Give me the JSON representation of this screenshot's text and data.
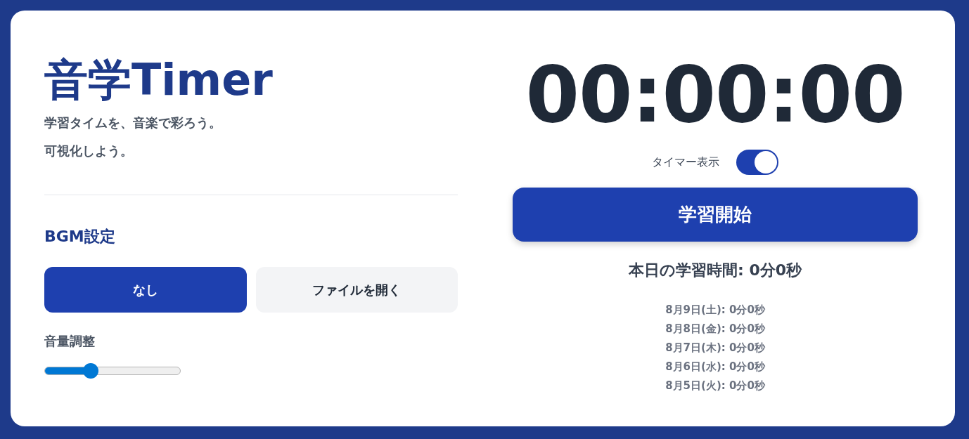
{
  "app": {
    "title": "音学Timer",
    "taglines": [
      "学習タイムを、音楽で彩ろう。",
      "可視化しよう。"
    ]
  },
  "bgm": {
    "heading": "BGM設定",
    "options": [
      {
        "label": "なし",
        "selected": true
      },
      {
        "label": "ファイルを開く",
        "selected": false
      }
    ],
    "volume": {
      "label": "音量調整",
      "level": 0.32
    }
  },
  "timer": {
    "display": "00:00:00",
    "visibility_toggle": {
      "label": "タイマー表示",
      "on": true
    },
    "start_button": "学習開始",
    "today_total": "本日の学習時間: 0分0秒",
    "history": [
      "8月9日(土): 0分0秒",
      "8月8日(金): 0分0秒",
      "8月7日(木): 0分0秒",
      "8月6日(水): 0分0秒",
      "8月5日(火): 0分0秒"
    ]
  }
}
